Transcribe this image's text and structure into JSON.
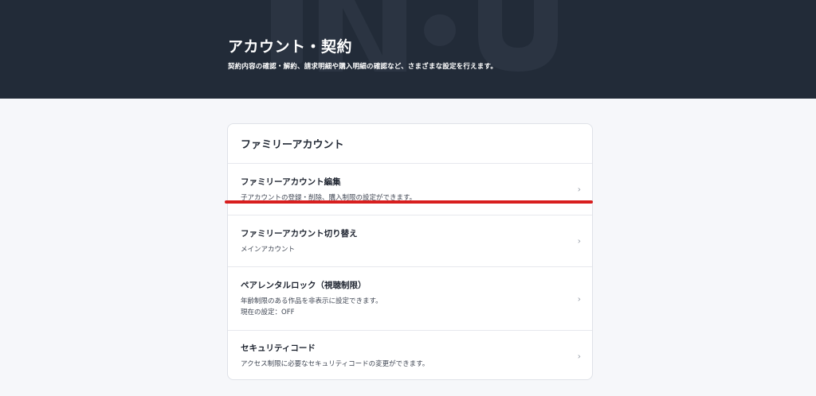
{
  "hero": {
    "title": "アカウント・契約",
    "subtitle": "契約内容の確認・解約、請求明細や購入明細の確認など、さまざまな設定を行えます。"
  },
  "card": {
    "header": "ファミリーアカウント",
    "items": [
      {
        "title": "ファミリーアカウント編集",
        "desc": "子アカウントの登録・削除、購入制限の設定ができます。",
        "chevron": "›"
      },
      {
        "title": "ファミリーアカウント切り替え",
        "desc": "メインアカウント",
        "chevron": "›"
      },
      {
        "title": "ペアレンタルロック（視聴制限）",
        "desc": "年齢制限のある作品を非表示に設定できます。",
        "desc2": "現在の設定：OFF",
        "chevron": "›"
      },
      {
        "title": "セキュリティコード",
        "desc": "アクセス制限に必要なセキュリティコードの変更ができます。",
        "chevron": "›"
      }
    ]
  },
  "colors": {
    "hero_bg": "#222b38",
    "page_bg": "#f6f7fa",
    "annotation_red": "#d81e1e"
  },
  "icons": {
    "row_chevron": "chevron-right-icon"
  }
}
